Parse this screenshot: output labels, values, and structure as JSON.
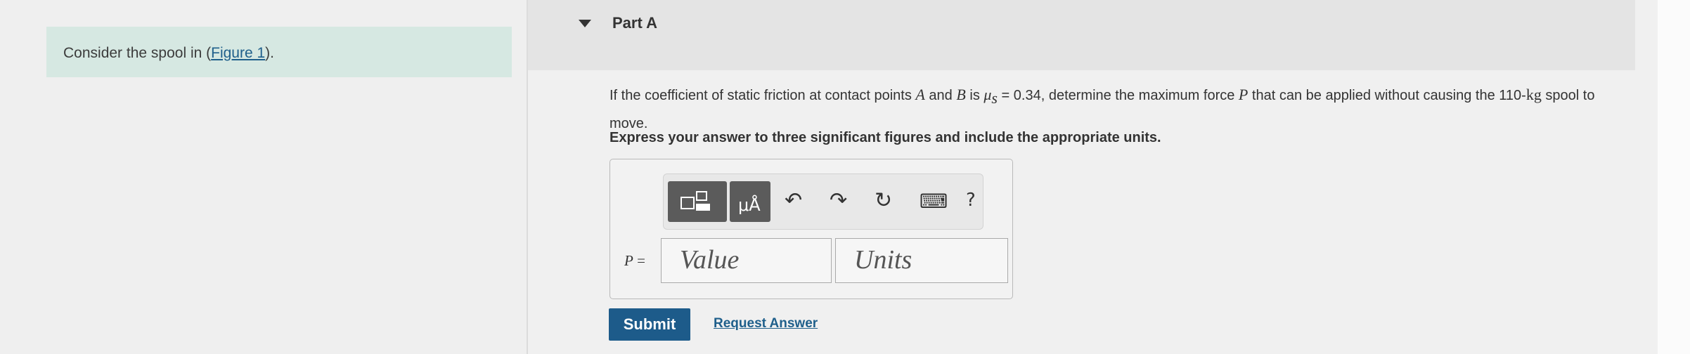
{
  "left_panel": {
    "prompt_prefix": "Consider the spool in (",
    "figure_link": "Figure 1",
    "prompt_suffix": ")."
  },
  "part": {
    "title": "Part A"
  },
  "question": {
    "text_1": "If the coefficient of static friction at contact points ",
    "var_a": "A",
    "text_2": " and ",
    "var_b": "B",
    "text_3": " is ",
    "var_mu": "μ",
    "var_mu_sub": "s",
    "text_4": " = 0.34, determine the maximum force ",
    "var_p": "P",
    "text_5": " that can be applied without causing the 110-",
    "unit_kg": "kg",
    "text_6": " spool to move."
  },
  "instruction": "Express your answer to three significant figures and include the appropriate units.",
  "answer": {
    "variable": "P",
    "equals": " =",
    "value_placeholder": "Value",
    "units_placeholder": "Units"
  },
  "toolbar": {
    "templates_icon": "templates-icon",
    "units_icon": "units-icon",
    "units_glyph": "μÅ",
    "undo_glyph": "↶",
    "redo_glyph": "↷",
    "reset_glyph": "↻",
    "keyboard_glyph": "⌨",
    "help_glyph": "?"
  },
  "actions": {
    "submit_label": "Submit",
    "request_answer_label": "Request Answer"
  },
  "colors": {
    "accent": "#1d5b8a",
    "prompt_bg": "#d6e8e2",
    "link": "#1f5f8b"
  }
}
